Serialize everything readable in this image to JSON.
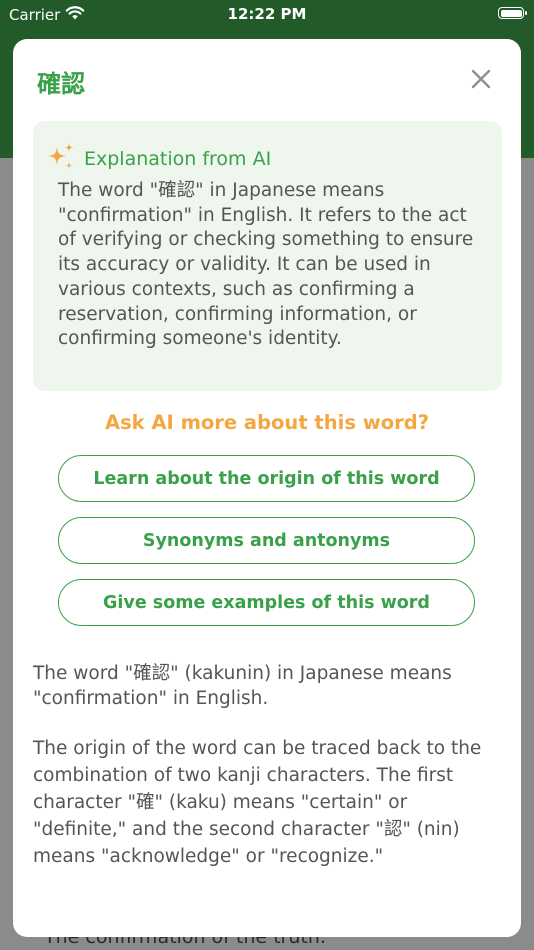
{
  "status_bar": {
    "carrier": "Carrier",
    "time": "12:22 PM"
  },
  "background": {
    "text": "The confirmation of the truth."
  },
  "modal": {
    "title": "確認",
    "ai_card": {
      "heading": "Explanation from AI",
      "text": "The word \"確認\" in Japanese means \"confirmation\" in English. It refers to the act of verifying or checking something to ensure its accuracy or validity. It can be used in various contexts, such as confirming a reservation, confirming information, or confirming someone's identity."
    },
    "ask_title": "Ask AI more about this word?",
    "buttons": [
      {
        "label": "Learn about the origin of this word"
      },
      {
        "label": "Synonyms and antonyms"
      },
      {
        "label": "Give some examples of this word"
      }
    ],
    "answer": [
      "The word \"確認\" (kakunin) in Japanese means \"confirmation\" in English.",
      "The origin of the word can be traced back to the combination of two kanji characters. The first character \"確\" (kaku) means \"certain\" or \"definite,\" and the second character \"認\" (nin) means \"acknowledge\" or \"recognize.\""
    ]
  },
  "colors": {
    "accent": "#3aa14a",
    "header": "#225a2a",
    "ask": "#f4a640",
    "card_bg": "#eef6ee"
  },
  "icons": {
    "close": "close-icon",
    "sparkle": "sparkle-icon",
    "wifi": "wifi-icon",
    "battery": "battery-icon"
  }
}
